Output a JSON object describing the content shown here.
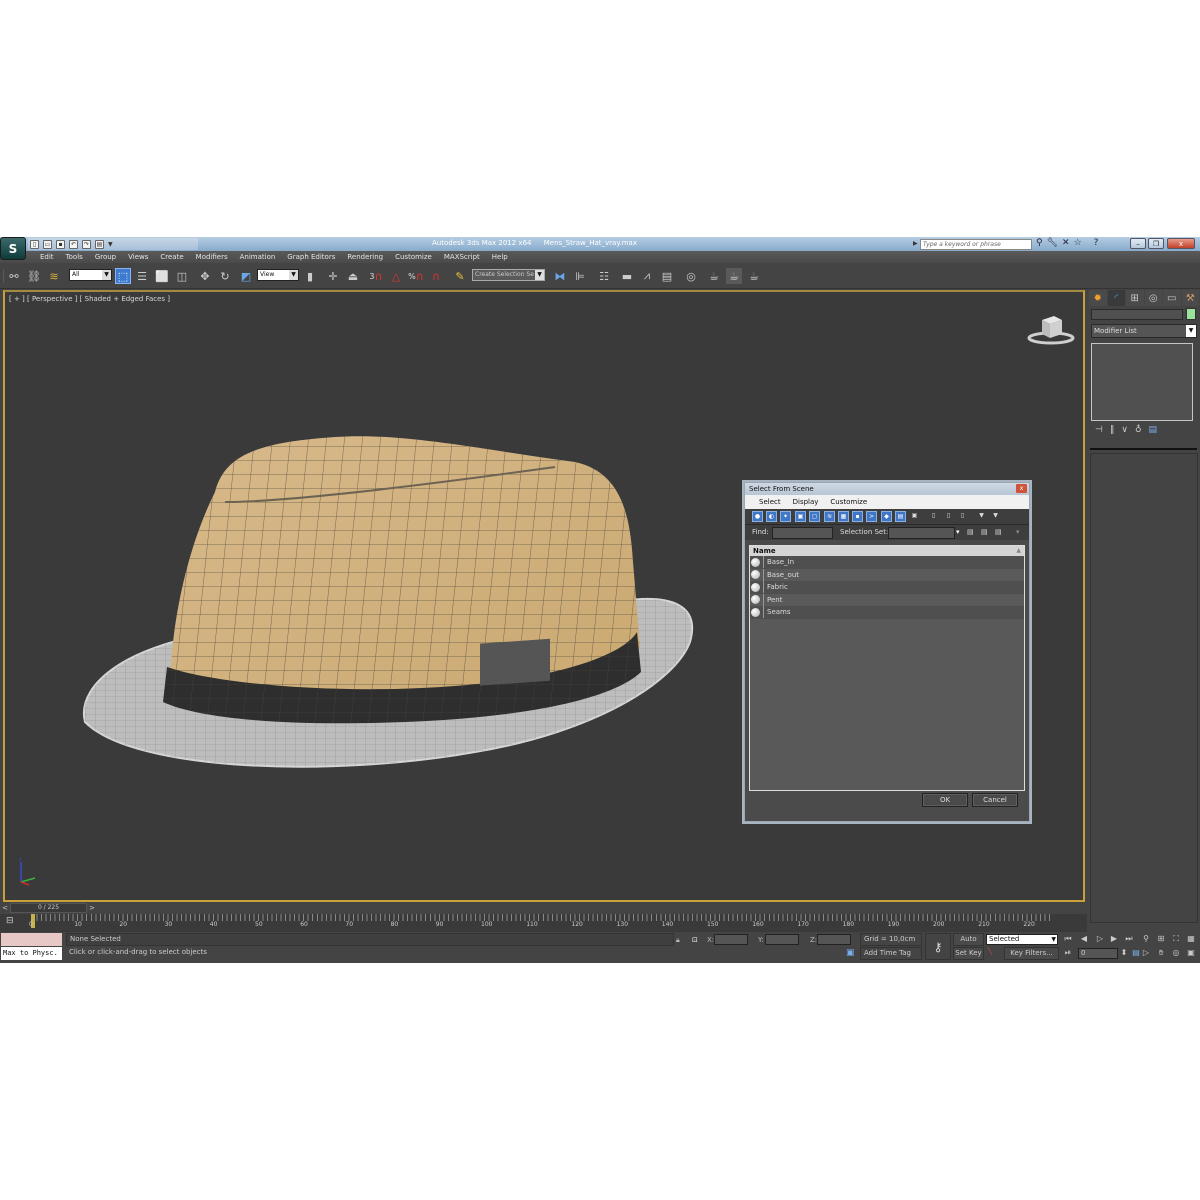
{
  "titlebar": {
    "app_title": "Autodesk 3ds Max  2012 x64",
    "file_name": "Mens_Straw_Hat_vray.max",
    "search_placeholder": "Type a keyword or phrase",
    "icons": [
      "binoculars-icon",
      "wrench-icon",
      "satellite-icon",
      "star-icon",
      "help-icon"
    ],
    "window_buttons": {
      "minimize": "–",
      "restore": "❐",
      "close": "x"
    }
  },
  "menu": [
    "Edit",
    "Tools",
    "Group",
    "Views",
    "Create",
    "Modifiers",
    "Animation",
    "Graph Editors",
    "Rendering",
    "Customize",
    "MAXScript",
    "Help"
  ],
  "toolbar": {
    "selection_filter": "All",
    "reference_coord": "View",
    "named_selection": "Create Selection Se",
    "snap_labels": {
      "snap3": "3",
      "percent": "%"
    }
  },
  "viewport": {
    "label": "[ + ] [ Perspective ] [ Shaded + Edged Faces ]",
    "axis_label": "z"
  },
  "dialog": {
    "title": "Select From Scene",
    "menu": [
      "Select",
      "Display",
      "Customize"
    ],
    "find_label": "Find:",
    "find_value": "",
    "selection_set_label": "Selection Set:",
    "selection_set_value": "",
    "column_name": "Name",
    "items": [
      "Base_In",
      "Base_out",
      "Fabric",
      "Pent",
      "Seams"
    ],
    "ok_label": "OK",
    "cancel_label": "Cancel"
  },
  "command_panel": {
    "tabs": [
      "create-icon",
      "modify-icon",
      "hierarchy-icon",
      "motion-icon",
      "display-icon",
      "utilities-icon"
    ],
    "object_name": "",
    "object_color": "#9be39b",
    "modifier_list": "Modifier List"
  },
  "timeline": {
    "frame_display": "0 / 225",
    "prev": "<",
    "next": ">",
    "ticks": [
      "0",
      "10",
      "20",
      "30",
      "40",
      "50",
      "60",
      "70",
      "80",
      "90",
      "100",
      "110",
      "120",
      "130",
      "140",
      "150",
      "160",
      "170",
      "180",
      "190",
      "200",
      "210",
      "220"
    ],
    "current_frame": 0,
    "total_frames": 225
  },
  "status": {
    "maxscript_listener": "Max to Physc.",
    "selection_status": "None Selected",
    "prompt": "Click or click-and-drag to select objects",
    "x_label": "X:",
    "y_label": "Y:",
    "z_label": "Z:",
    "x_value": "",
    "y_value": "",
    "z_value": "",
    "grid": "Grid = 10,0cm",
    "add_time_tag": "Add Time Tag",
    "auto_key": "Auto Key",
    "set_key": "Set Key",
    "key_mode": "Selected",
    "key_filters": "Key Filters...",
    "frame_value": "0"
  }
}
